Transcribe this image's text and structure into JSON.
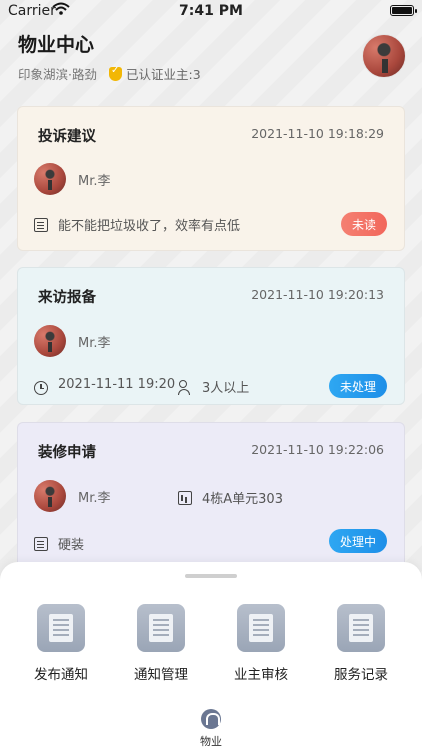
{
  "status_bar": {
    "carrier": "Carrier",
    "time": "7:41 PM"
  },
  "header": {
    "title": "物业中心",
    "community": "印象湖滨·路劲",
    "verified": "已认证业主:3"
  },
  "cards": [
    {
      "title": "投诉建议",
      "date": "2021-11-10 19:18:29",
      "user": "Mr.李",
      "detail": "能不能把垃圾收了，效率有点低",
      "status": "未读"
    },
    {
      "title": "来访报备",
      "date": "2021-11-10 19:20:13",
      "user": "Mr.李",
      "visit_time": "2021-11-11 19:20",
      "visitors": "3人以上",
      "status": "未处理"
    },
    {
      "title": "装修申请",
      "date": "2021-11-10 19:22:06",
      "user": "Mr.李",
      "unit": "4栋A单元303",
      "detail": "硬装",
      "status": "处理中"
    }
  ],
  "menu": [
    {
      "label": "发布通知",
      "icon": "publish-notice-icon"
    },
    {
      "label": "通知管理",
      "icon": "notice-manage-icon"
    },
    {
      "label": "业主审核",
      "icon": "owner-review-icon"
    },
    {
      "label": "服务记录",
      "icon": "service-record-icon"
    }
  ],
  "tab_bar": {
    "label": "物业"
  },
  "colors": {
    "red_badge": "#f2665b",
    "blue_badge": "#1e8fe8",
    "card1_bg": "#f9f3ea",
    "card2_bg": "#eaf4f6",
    "card3_bg": "#ecebf7"
  }
}
